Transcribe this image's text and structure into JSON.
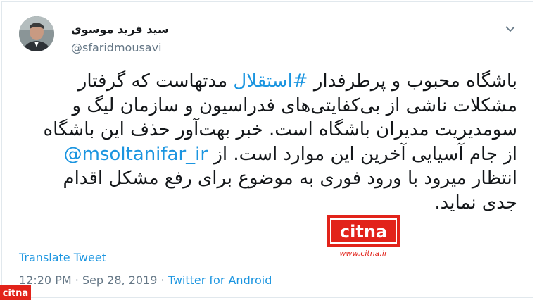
{
  "user": {
    "name": "سید فرید موسوی",
    "handle": "@sfaridmousavi"
  },
  "tweet": {
    "line1": {
      "pre": "باشگاه محبوب و پرطرفدار ",
      "hashtag": "#استقلال",
      "post": " مدتهاست که گرفتار"
    },
    "line2": "مشکلات ناشی از بی‌کفایتی‌های فدراسیون و سازمان لیگ و",
    "line3": "سومدیریت مدیران باشگاه است. خبر بهت‌آور حذف این باشگاه",
    "line4": {
      "pre": "از جام آسیایی آخرین این موارد است. از ",
      "mention": "@msoltanifar_ir"
    },
    "line5": "انتظار میرود با ورود فوری به موضوع برای رفع مشکل اقدام",
    "line6": "جدی نماید."
  },
  "translate_label": "Translate Tweet",
  "meta": {
    "time": "12:20 PM",
    "separator": " · ",
    "date": "Sep 28, 2019",
    "source": "Twitter for Android"
  },
  "watermark": {
    "brand": "citna",
    "url": "www.citna.ir"
  },
  "colors": {
    "link": "#1b95e0",
    "text": "#14171a",
    "muted": "#657786",
    "citna_red": "#e2231a"
  },
  "icons": {
    "caret": "chevron-down-icon"
  }
}
